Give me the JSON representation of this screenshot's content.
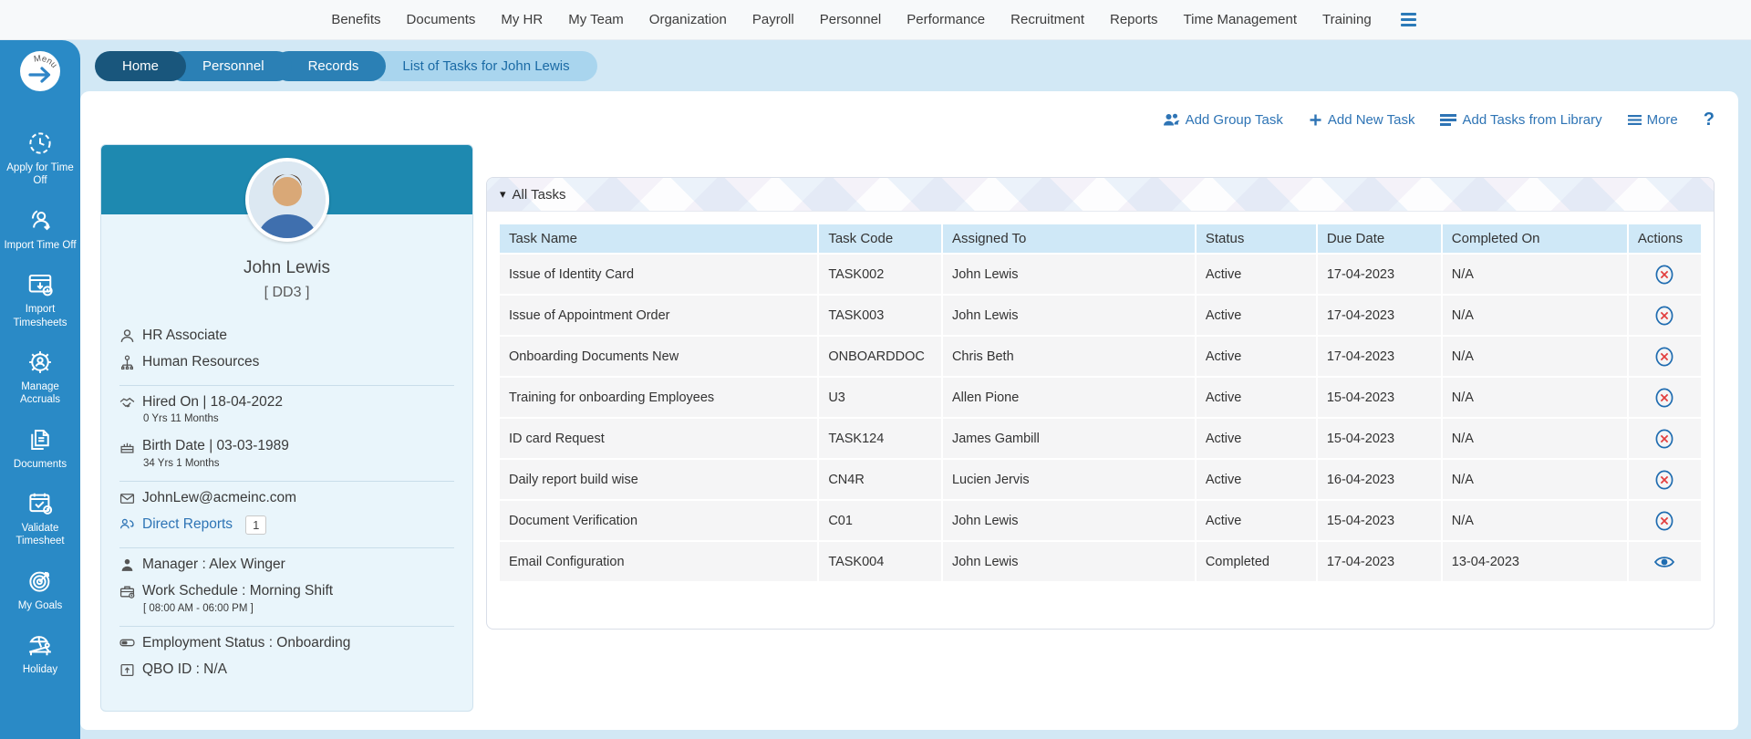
{
  "topnav": {
    "items": [
      "Benefits",
      "Documents",
      "My HR",
      "My Team",
      "Organization",
      "Payroll",
      "Personnel",
      "Performance",
      "Recruitment",
      "Reports",
      "Time Management",
      "Training"
    ]
  },
  "tabs": {
    "items": [
      {
        "label": "Home",
        "variant": "dark"
      },
      {
        "label": "Personnel",
        "variant": "mid"
      },
      {
        "label": "Records",
        "variant": "mid"
      },
      {
        "label": "List of Tasks for John Lewis",
        "variant": "active"
      }
    ]
  },
  "actions": {
    "add_group_task": "Add Group Task",
    "add_new_task": "Add New Task",
    "add_tasks_from_library": "Add Tasks from Library",
    "more": "More",
    "help": "?"
  },
  "sidebar": {
    "menu_label": "Menu",
    "items": [
      {
        "label": "Apply for Time Off",
        "icon": "clock"
      },
      {
        "label": "Import Time Off",
        "icon": "import-person"
      },
      {
        "label": "Import Timesheets",
        "icon": "import-sheet"
      },
      {
        "label": "Manage Accruals",
        "icon": "gear-user"
      },
      {
        "label": "Documents",
        "icon": "documents"
      },
      {
        "label": "Validate Timesheet",
        "icon": "calendar-check"
      },
      {
        "label": "My Goals",
        "icon": "target"
      },
      {
        "label": "Holiday",
        "icon": "beach"
      }
    ]
  },
  "profile": {
    "name": "John Lewis",
    "code": "[ DD3 ]",
    "role": "HR Associate",
    "department": "Human Resources",
    "hired": "Hired On | 18-04-2022",
    "tenure": "0 Yrs 11 Months",
    "birth": "Birth Date | 03-03-1989",
    "age": "34 Yrs 1 Months",
    "email": "JohnLew@acmeinc.com",
    "direct_reports_label": "Direct Reports",
    "direct_reports_count": "1",
    "manager": "Manager : Alex Winger",
    "work_schedule": "Work Schedule : Morning Shift",
    "work_hours": "[ 08:00 AM - 06:00 PM ]",
    "employment_status": "Employment Status : Onboarding",
    "qbo_id": "QBO ID : N/A"
  },
  "tasks": {
    "section_title": "All Tasks",
    "columns": [
      "Task Name",
      "Task Code",
      "Assigned To",
      "Status",
      "Due Date",
      "Completed On",
      "Actions"
    ],
    "rows": [
      {
        "task_name": "Issue of Identity Card",
        "task_code": "TASK002",
        "assigned_to": "John Lewis",
        "status": "Active",
        "due_date": "17-04-2023",
        "completed_on": "N/A",
        "action": "delete"
      },
      {
        "task_name": "Issue of Appointment Order",
        "task_code": "TASK003",
        "assigned_to": "John Lewis",
        "status": "Active",
        "due_date": "17-04-2023",
        "completed_on": "N/A",
        "action": "delete"
      },
      {
        "task_name": "Onboarding Documents New",
        "task_code": "ONBOARDDOC",
        "assigned_to": "Chris Beth",
        "status": "Active",
        "due_date": "17-04-2023",
        "completed_on": "N/A",
        "action": "delete"
      },
      {
        "task_name": "Training for onboarding Employees",
        "task_code": "U3",
        "assigned_to": "Allen Pione",
        "status": "Active",
        "due_date": "15-04-2023",
        "completed_on": "N/A",
        "action": "delete"
      },
      {
        "task_name": "ID card Request",
        "task_code": "TASK124",
        "assigned_to": "James Gambill",
        "status": "Active",
        "due_date": "15-04-2023",
        "completed_on": "N/A",
        "action": "delete"
      },
      {
        "task_name": "Daily report build wise",
        "task_code": "CN4R",
        "assigned_to": "Lucien Jervis",
        "status": "Active",
        "due_date": "16-04-2023",
        "completed_on": "N/A",
        "action": "delete"
      },
      {
        "task_name": "Document Verification",
        "task_code": "C01",
        "assigned_to": "John Lewis",
        "status": "Active",
        "due_date": "15-04-2023",
        "completed_on": "N/A",
        "action": "delete"
      },
      {
        "task_name": "Email Configuration",
        "task_code": "TASK004",
        "assigned_to": "John Lewis",
        "status": "Completed",
        "due_date": "17-04-2023",
        "completed_on": "13-04-2023",
        "action": "view"
      }
    ]
  },
  "colors": {
    "sidebar_blue": "#2a8ac6",
    "tab_dark": "#19567c",
    "tab_mid": "#2b80b5",
    "tab_active_bg": "#a9d5ee",
    "link_blue": "#2e74b5",
    "card_header_teal": "#1e89b0",
    "card_bg": "#e9f5fb",
    "table_header_bg": "#cfe8f7",
    "row_bg": "#f5f5f6",
    "delete_red": "#e23d3d",
    "icon_blue": "#1f6cb0"
  }
}
